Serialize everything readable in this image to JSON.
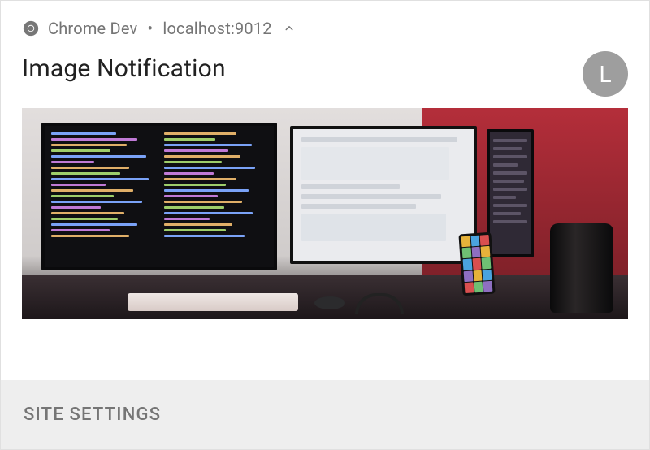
{
  "header": {
    "app_name": "Chrome Dev",
    "separator": "•",
    "origin": "localhost:9012"
  },
  "notification": {
    "title": "Image Notification",
    "avatar_initial": "L",
    "image_alt": "desk-with-monitors-photo"
  },
  "actions": {
    "site_settings_label": "SITE SETTINGS"
  },
  "colors": {
    "text_secondary": "#757575",
    "text_primary": "#212121",
    "avatar_bg": "#9e9e9e",
    "action_bg": "#eeeeee"
  }
}
